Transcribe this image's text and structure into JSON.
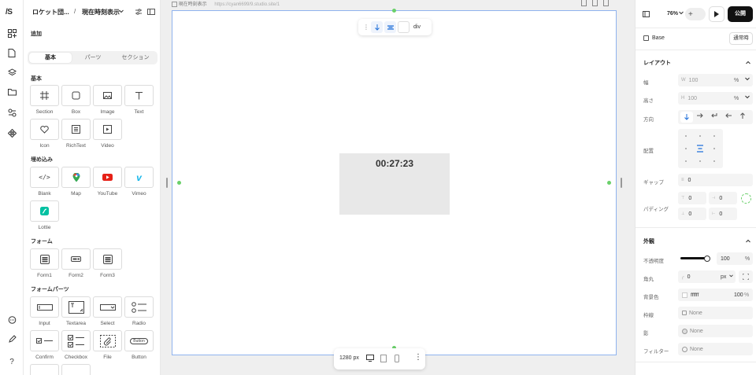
{
  "rail": {
    "logo": "/S"
  },
  "left_panel": {
    "project_name": "ロケット団...",
    "separator": "/",
    "page_name": "現在時刻表示",
    "add_label": "追加",
    "tabs": [
      {
        "label": "基本",
        "selected": true
      },
      {
        "label": "パーツ",
        "selected": false
      },
      {
        "label": "セクション",
        "selected": false
      }
    ],
    "sections": {
      "basic": "基本",
      "embed": "埋め込み",
      "form": "フォーム",
      "form_parts": "フォームパーツ"
    },
    "basic": [
      "Section",
      "Box",
      "Image",
      "Text",
      "Icon",
      "RichText",
      "Video"
    ],
    "embed": [
      "Blank",
      "Map",
      "YouTube",
      "Vimeo",
      "Lottie"
    ],
    "form": [
      "Form1",
      "Form2",
      "Form3"
    ],
    "form_parts": [
      "Input",
      "Textarea",
      "Select",
      "Radio",
      "Confirm",
      "Checkbox",
      "File",
      "Button"
    ]
  },
  "canvas": {
    "tab_label": "現在時刻表示",
    "url": "https://cyan6699/9.studio.site/1",
    "toolbar_tag": "div",
    "clock_text": "00:27:23",
    "viewport": "1280 px",
    "accent": "#1f6fd9"
  },
  "right_panel": {
    "zoom": "76%",
    "publish": "公開",
    "base_label": "Base",
    "state": "通常時",
    "layout_title": "レイアウト",
    "width_label": "幅",
    "width_prefix": "W",
    "width_value": "100",
    "width_unit": "%",
    "height_label": "高さ",
    "height_prefix": "H",
    "height_value": "100",
    "height_unit": "%",
    "direction_label": "方向",
    "align_label": "配置",
    "gap_label": "ギャップ",
    "gap_value": "0",
    "padding_label": "パディング",
    "padding_values": [
      "0",
      "0",
      "0",
      "0"
    ],
    "appearance_title": "外観",
    "opacity_label": "不透明度",
    "opacity_value": "100",
    "opacity_unit": "%",
    "opacity_level": 1.0,
    "radius_label": "角丸",
    "radius_value": "0",
    "radius_unit": "px",
    "bg_label": "背景色",
    "bg_value": "ffffff",
    "bg_opacity": "100",
    "bg_opacity_unit": "%",
    "border_label": "枠線",
    "border_value": "None",
    "shadow_label": "影",
    "shadow_value": "None",
    "filter_label": "フィルター",
    "filter_value": "None"
  }
}
